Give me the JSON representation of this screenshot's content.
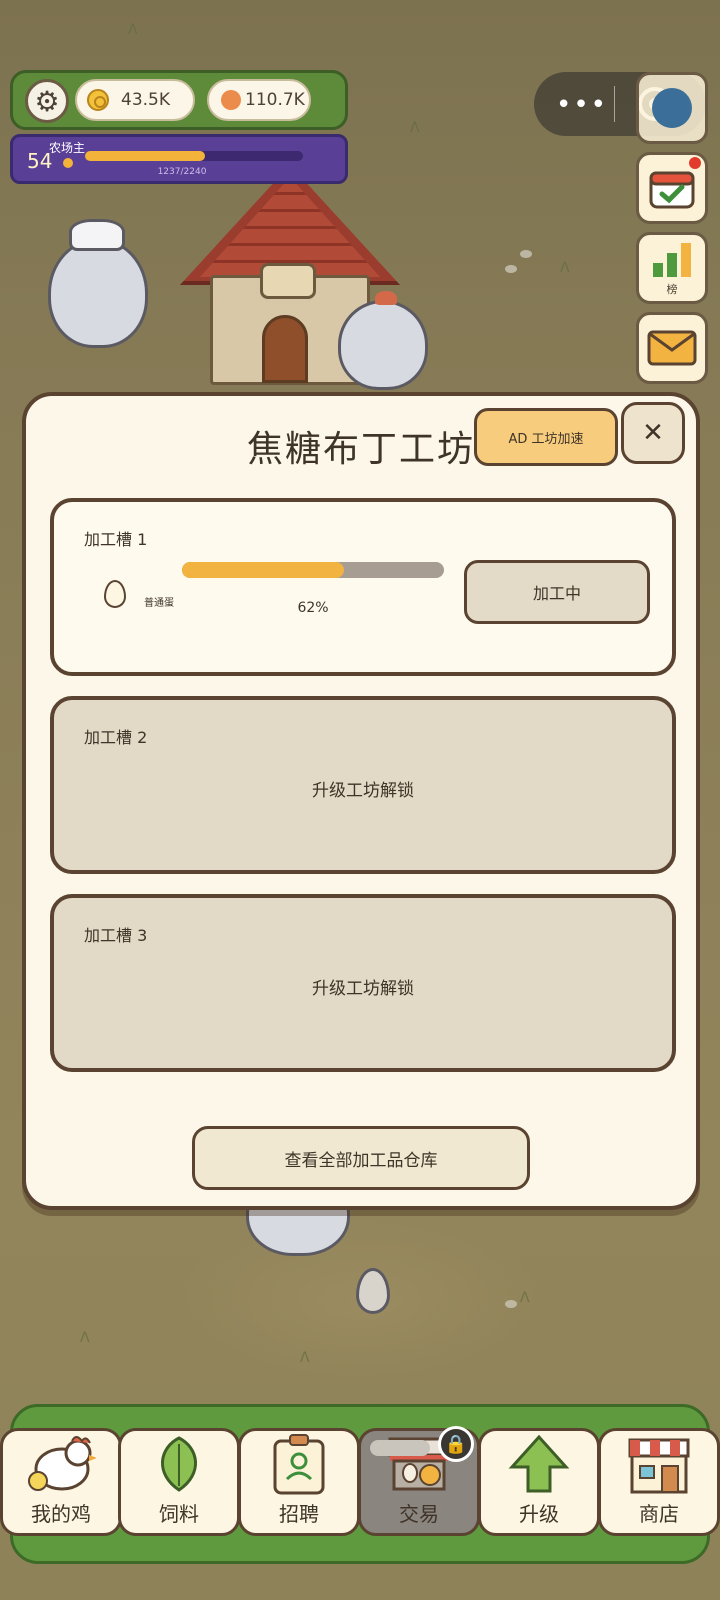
{
  "hud": {
    "coins": "43.5K",
    "gems": "110.7K",
    "level": "54",
    "rank_title": "农场主",
    "xp_text": "1237/2240",
    "xp_progress": 0.552
  },
  "side_buttons": {
    "leaderboard_label": "榜"
  },
  "modal": {
    "title": "焦糖布丁工坊",
    "ad_button": "AD 工坊加速",
    "close_symbol": "✕",
    "slots": [
      {
        "label": "加工槽 1",
        "item_name": "普通蛋",
        "progress_text": "62%",
        "progress": 0.62,
        "status": "加工中"
      },
      {
        "label": "加工槽 2",
        "lock_text": "升级工坊解锁"
      },
      {
        "label": "加工槽 3",
        "lock_text": "升级工坊解锁"
      }
    ],
    "storage_button": "查看全部加工品仓库"
  },
  "nav": [
    {
      "label": "我的鸡",
      "icon": "chicken-icon"
    },
    {
      "label": "饲料",
      "icon": "leaf-icon"
    },
    {
      "label": "招聘",
      "icon": "id-card-icon"
    },
    {
      "label": "交易",
      "icon": "market-stall-icon",
      "locked": true
    },
    {
      "label": "升级",
      "icon": "up-arrow-icon"
    },
    {
      "label": "商店",
      "icon": "shop-icon"
    }
  ],
  "colors": {
    "accent_orange": "#f2b340",
    "ad_button": "#f8cc7d",
    "panel": "#fdf7ea",
    "nav_green": "#5f9a3e",
    "level_purple": "#5a3f97"
  }
}
